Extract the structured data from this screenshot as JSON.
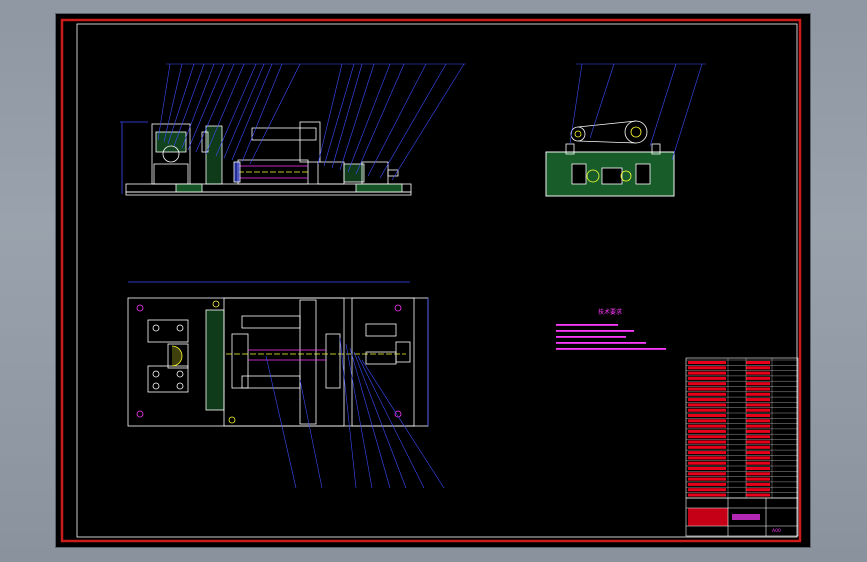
{
  "colors": {
    "frame": "#cc1b1b",
    "geometry": "#ffffff",
    "leader": "#3a4cff",
    "hatch": "#2aa84a",
    "accent": "#ffff33",
    "magenta": "#ff39ff",
    "table_fill": "#e8001a"
  },
  "notes": {
    "title": "技术要求"
  },
  "title_block": {
    "scale_label": "比例",
    "sheet_code": "A00"
  }
}
